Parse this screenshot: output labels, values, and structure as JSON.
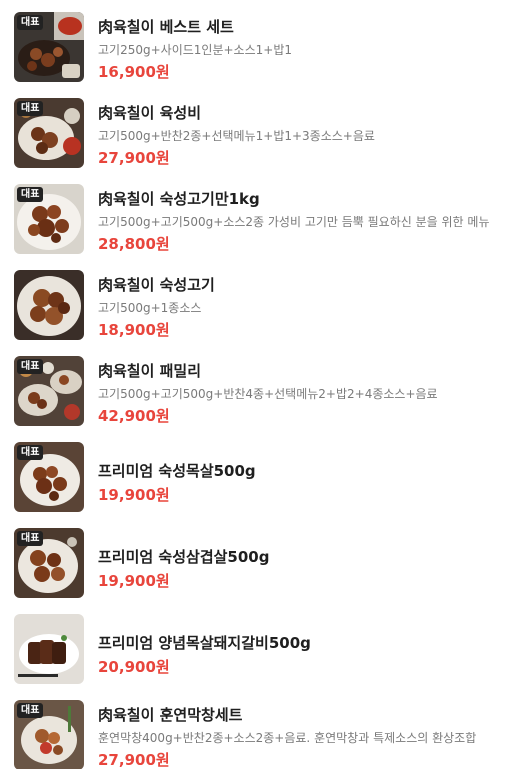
{
  "badge_label": "대표",
  "colors": {
    "price": "#e8453c",
    "title": "#1f1f1f",
    "desc": "#7a7a7a",
    "badge_bg": "#222222"
  },
  "items": [
    {
      "title": "肉육칠이 베스트 세트",
      "desc": "고기250g+사이드1인분+소스1+밥1",
      "price": "16,900원",
      "badge": true
    },
    {
      "title": "肉육칠이 육성비",
      "desc": "고기500g+반찬2종+선택메뉴1+밥1+3종소스+음료",
      "price": "27,900원",
      "badge": true
    },
    {
      "title": "肉육칠이 숙성고기만1kg",
      "desc": "고기500g+고기500g+소스2종 가성비 고기만 듬뿍 필요하신 분을 위한 메뉴",
      "price": "28,800원",
      "badge": true
    },
    {
      "title": "肉육칠이 숙성고기",
      "desc": "고기500g+1종소스",
      "price": "18,900원",
      "badge": false
    },
    {
      "title": "肉육칠이 패밀리",
      "desc": "고기500g+고기500g+반찬4종+선택메뉴2+밥2+4종소스+음료",
      "price": "42,900원",
      "badge": true
    },
    {
      "title": "프리미엄 숙성목살500g",
      "desc": "",
      "price": "19,900원",
      "badge": true
    },
    {
      "title": "프리미엄 숙성삼겹살500g",
      "desc": "",
      "price": "19,900원",
      "badge": true
    },
    {
      "title": "프리미엄 양념목살돼지갈비500g",
      "desc": "",
      "price": "20,900원",
      "badge": false
    },
    {
      "title": "肉육칠이 훈연막창세트",
      "desc": "훈연막창400g+반찬2종+소스2종+음료. 훈연막창과 특제소스의 환상조합",
      "price": "27,900원",
      "badge": true
    }
  ]
}
